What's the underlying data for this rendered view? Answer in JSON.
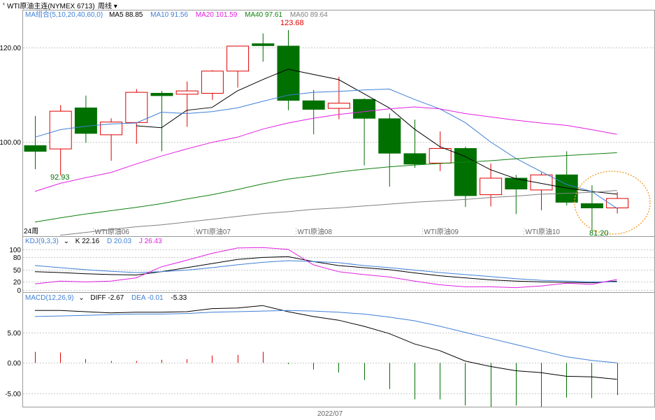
{
  "title": {
    "instrument": "WTI原油主连(NYMEX 6713)",
    "period": "周线"
  },
  "main_legend": {
    "group": "MA组合(5,10,20,40,60,0)",
    "items": [
      {
        "label": "MA5 88.85",
        "color": "#000000"
      },
      {
        "label": "MA10 91.56",
        "color": "#3f7fd6"
      },
      {
        "label": "MA20 101.59",
        "color": "#e020e0"
      },
      {
        "label": "MA40 97.61",
        "color": "#108010"
      },
      {
        "label": "MA60 89.64",
        "color": "#808080"
      }
    ]
  },
  "kdj_legend": {
    "group": "KDJ(9,3,3)",
    "items": [
      {
        "label": "K 22.16",
        "color": "#000000"
      },
      {
        "label": "D 20.03",
        "color": "#3f7fd6"
      },
      {
        "label": "J 26.43",
        "color": "#e020e0"
      }
    ]
  },
  "macd_legend": {
    "group": "MACD(12,26,9)",
    "items": [
      {
        "label": "DIFF -2.67",
        "color": "#000000"
      },
      {
        "label": "DEA -0.01",
        "color": "#3f7fd6"
      },
      {
        "label": "-5.33",
        "color": "#000000"
      }
    ]
  },
  "annotations": {
    "high": "123.68",
    "low_left": "92.93",
    "low_right": "81.20",
    "period_label": "24周",
    "date_label": "2022/07"
  },
  "colors": {
    "up": "#e00000",
    "down": "#007000",
    "highlight": "#f0a030"
  },
  "chart_data": [
    {
      "type": "candlestick",
      "y_axis": {
        "ticks": [
          100.0,
          120.0
        ],
        "ylim": [
          80,
          128
        ]
      },
      "x_ticks": [
        "WTI原油06",
        "WTI原油07",
        "WTI原油08",
        "WTI原油09",
        "WTI原油10"
      ],
      "x_tick_index": [
        2.3,
        6.3,
        10.3,
        15.3,
        19.3
      ],
      "candles": [
        {
          "o": 99.2,
          "h": 105.5,
          "l": 94.2,
          "c": 98.0
        },
        {
          "o": 98.5,
          "h": 107.8,
          "l": 92.9,
          "c": 106.5
        },
        {
          "o": 107.2,
          "h": 109.8,
          "l": 99.8,
          "c": 101.8
        },
        {
          "o": 101.5,
          "h": 105.0,
          "l": 96.0,
          "c": 104.2
        },
        {
          "o": 104.1,
          "h": 111.2,
          "l": 99.6,
          "c": 110.5
        },
        {
          "o": 110.3,
          "h": 110.8,
          "l": 98.0,
          "c": 109.8
        },
        {
          "o": 110.1,
          "h": 112.8,
          "l": 103.2,
          "c": 110.8
        },
        {
          "o": 110.3,
          "h": 115.2,
          "l": 108.9,
          "c": 115.0
        },
        {
          "o": 115.0,
          "h": 120.3,
          "l": 111.5,
          "c": 120.3
        },
        {
          "o": 120.8,
          "h": 123.0,
          "l": 117.0,
          "c": 120.4
        },
        {
          "o": 120.3,
          "h": 123.7,
          "l": 106.7,
          "c": 108.8
        },
        {
          "o": 108.7,
          "h": 111.0,
          "l": 101.6,
          "c": 106.9
        },
        {
          "o": 107.1,
          "h": 113.8,
          "l": 104.8,
          "c": 108.2
        },
        {
          "o": 109.0,
          "h": 109.2,
          "l": 95.0,
          "c": 105.0
        },
        {
          "o": 104.9,
          "h": 106.0,
          "l": 90.5,
          "c": 97.6
        },
        {
          "o": 97.5,
          "h": 104.7,
          "l": 94.5,
          "c": 95.3
        },
        {
          "o": 95.5,
          "h": 102.2,
          "l": 93.8,
          "c": 98.6
        },
        {
          "o": 98.6,
          "h": 99.0,
          "l": 86.2,
          "c": 88.6
        },
        {
          "o": 88.8,
          "h": 95.4,
          "l": 86.3,
          "c": 92.3
        },
        {
          "o": 92.3,
          "h": 93.0,
          "l": 84.7,
          "c": 90.0
        },
        {
          "o": 89.8,
          "h": 93.5,
          "l": 85.5,
          "c": 93.0
        },
        {
          "o": 93.0,
          "h": 98.0,
          "l": 86.5,
          "c": 87.2
        },
        {
          "o": 86.9,
          "h": 90.8,
          "l": 81.2,
          "c": 86.0
        },
        {
          "o": 86.0,
          "h": 89.4,
          "l": 84.8,
          "c": 88.0
        }
      ],
      "series": [
        {
          "name": "MA5",
          "values": [
            null,
            null,
            null,
            null,
            103.4,
            103.0,
            106.7,
            107.3,
            110.8,
            113.2,
            115.4,
            114.3,
            113.2,
            110.2,
            107.2,
            102.7,
            99.0,
            96.9,
            94.1,
            92.2,
            91.2,
            90.2,
            89.5,
            88.9
          ]
        },
        {
          "name": "MA10",
          "values": [
            101.0,
            102.6,
            103.3,
            103.8,
            104.0,
            106.3,
            106.0,
            106.4,
            107.2,
            108.6,
            109.9,
            110.5,
            110.7,
            111.0,
            111.2,
            109.0,
            107.0,
            104.1,
            100.0,
            96.5,
            93.7,
            91.0,
            89.5,
            85.9
          ]
        },
        {
          "name": "MA20",
          "values": [
            89.5,
            91.2,
            92.4,
            93.5,
            95.3,
            97.0,
            98.5,
            99.9,
            101.0,
            102.7,
            104.0,
            105.0,
            105.8,
            106.4,
            107.0,
            107.4,
            107.0,
            106.0,
            105.3,
            104.6,
            104.0,
            103.5,
            102.6,
            101.6
          ]
        },
        {
          "name": "MA40",
          "values": [
            83.0,
            83.9,
            84.7,
            85.4,
            86.1,
            86.9,
            87.9,
            88.8,
            89.9,
            91.1,
            92.1,
            92.8,
            93.6,
            94.2,
            94.7,
            95.1,
            95.4,
            95.7,
            96.0,
            96.4,
            96.8,
            97.1,
            97.4,
            97.7
          ]
        },
        {
          "name": "MA60",
          "values": [
            null,
            80.2,
            80.8,
            81.4,
            82.0,
            82.4,
            83.0,
            83.6,
            84.2,
            84.8,
            85.2,
            85.7,
            86.0,
            86.4,
            86.8,
            87.2,
            87.5,
            87.8,
            88.2,
            88.5,
            88.9,
            89.1,
            89.3,
            89.7
          ]
        }
      ]
    },
    {
      "type": "line",
      "y_axis": {
        "ticks": [
          0,
          20,
          50,
          80,
          100
        ],
        "ylim": [
          -5,
          108
        ]
      },
      "series": [
        {
          "name": "K",
          "values": [
            45,
            43,
            40,
            38,
            37,
            45,
            55,
            65,
            75,
            80,
            82,
            70,
            60,
            55,
            50,
            42,
            35,
            30,
            25,
            22,
            20,
            19,
            18,
            22
          ]
        },
        {
          "name": "D",
          "values": [
            60,
            55,
            50,
            46,
            43,
            45,
            49,
            55,
            62,
            68,
            72,
            70,
            67,
            60,
            55,
            49,
            43,
            38,
            33,
            28,
            24,
            22,
            20,
            20
          ]
        },
        {
          "name": "J",
          "values": [
            15,
            22,
            20,
            22,
            30,
            57,
            73,
            90,
            103,
            104,
            100,
            62,
            45,
            38,
            32,
            22,
            13,
            8,
            8,
            6,
            10,
            17,
            14,
            26
          ]
        }
      ]
    },
    {
      "type": "bar+line",
      "y_axis": {
        "ticks": [
          5.0,
          0.0,
          -5.0
        ],
        "ylim": [
          -7.2,
          10
        ]
      },
      "series": [
        {
          "name": "DIFF",
          "values": [
            8.6,
            8.6,
            8.4,
            8.2,
            8.3,
            8.3,
            8.4,
            8.9,
            9.0,
            9.4,
            8.4,
            7.6,
            7.0,
            6.0,
            4.8,
            3.1,
            2.0,
            0.3,
            -0.6,
            -1.3,
            -1.6,
            -2.2,
            -2.3,
            -2.7
          ]
        },
        {
          "name": "DEA",
          "values": [
            7.6,
            7.7,
            7.8,
            7.9,
            8.0,
            8.0,
            8.1,
            8.3,
            8.4,
            8.5,
            8.6,
            8.5,
            8.3,
            8.0,
            7.5,
            6.9,
            6.0,
            5.0,
            4.0,
            3.0,
            2.0,
            1.0,
            0.4,
            -0.01
          ]
        },
        {
          "name": "MACD",
          "values": [
            1.8,
            1.7,
            0.6,
            0.3,
            0.3,
            0.5,
            0.6,
            1.2,
            1.3,
            1.8,
            -0.2,
            -1.1,
            -1.6,
            -2.8,
            -4.3,
            -6.0,
            -6.0,
            -7.0,
            -7.2,
            -7.0,
            -7.2,
            -5.7,
            -5.8,
            -5.3
          ]
        }
      ]
    }
  ]
}
